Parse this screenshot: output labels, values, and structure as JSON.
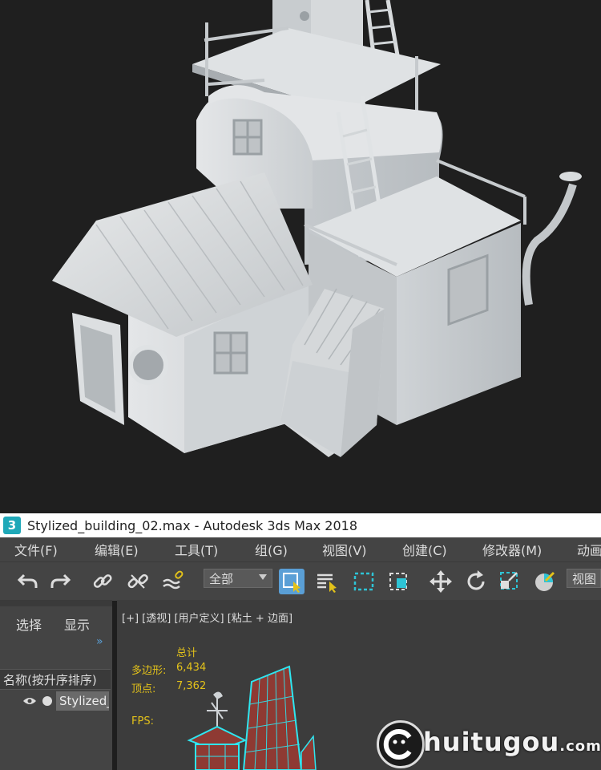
{
  "titlebar": {
    "logo_text": "3",
    "title": "Stylized_building_02.max - Autodesk 3ds Max 2018"
  },
  "menubar": {
    "items": [
      "文件(F)",
      "编辑(E)",
      "工具(T)",
      "组(G)",
      "视图(V)",
      "创建(C)",
      "修改器(M)",
      "动画"
    ]
  },
  "toolbar": {
    "selection_filter": "全部",
    "view_label": "视图",
    "icons": [
      "undo-icon",
      "redo-icon",
      "link-icon",
      "unlink-icon",
      "bind-space-warp-icon",
      "select-object-icon",
      "select-by-name-icon",
      "rectangular-selection-icon",
      "window-crossing-icon",
      "move-icon",
      "rotate-icon",
      "scale-icon",
      "reference-coordinate-icon"
    ],
    "accent": "#5a9fd6"
  },
  "scene_explorer": {
    "tab_select": "选择",
    "tab_display": "显示",
    "expand_glyph": "»",
    "column_header": "名称(按升序排序)",
    "object_name": "Stylized_"
  },
  "viewport": {
    "label": "[+] [透视] [用户定义] [粘土 + 边面]",
    "stats_total": "总计",
    "polygons_label": "多边形:",
    "polygons_value": "6,434",
    "vertices_label": "顶点:",
    "vertices_value": "7,362",
    "fps_label": "FPS:"
  },
  "watermark": {
    "text": "huitugou",
    "suffix": ".com"
  }
}
